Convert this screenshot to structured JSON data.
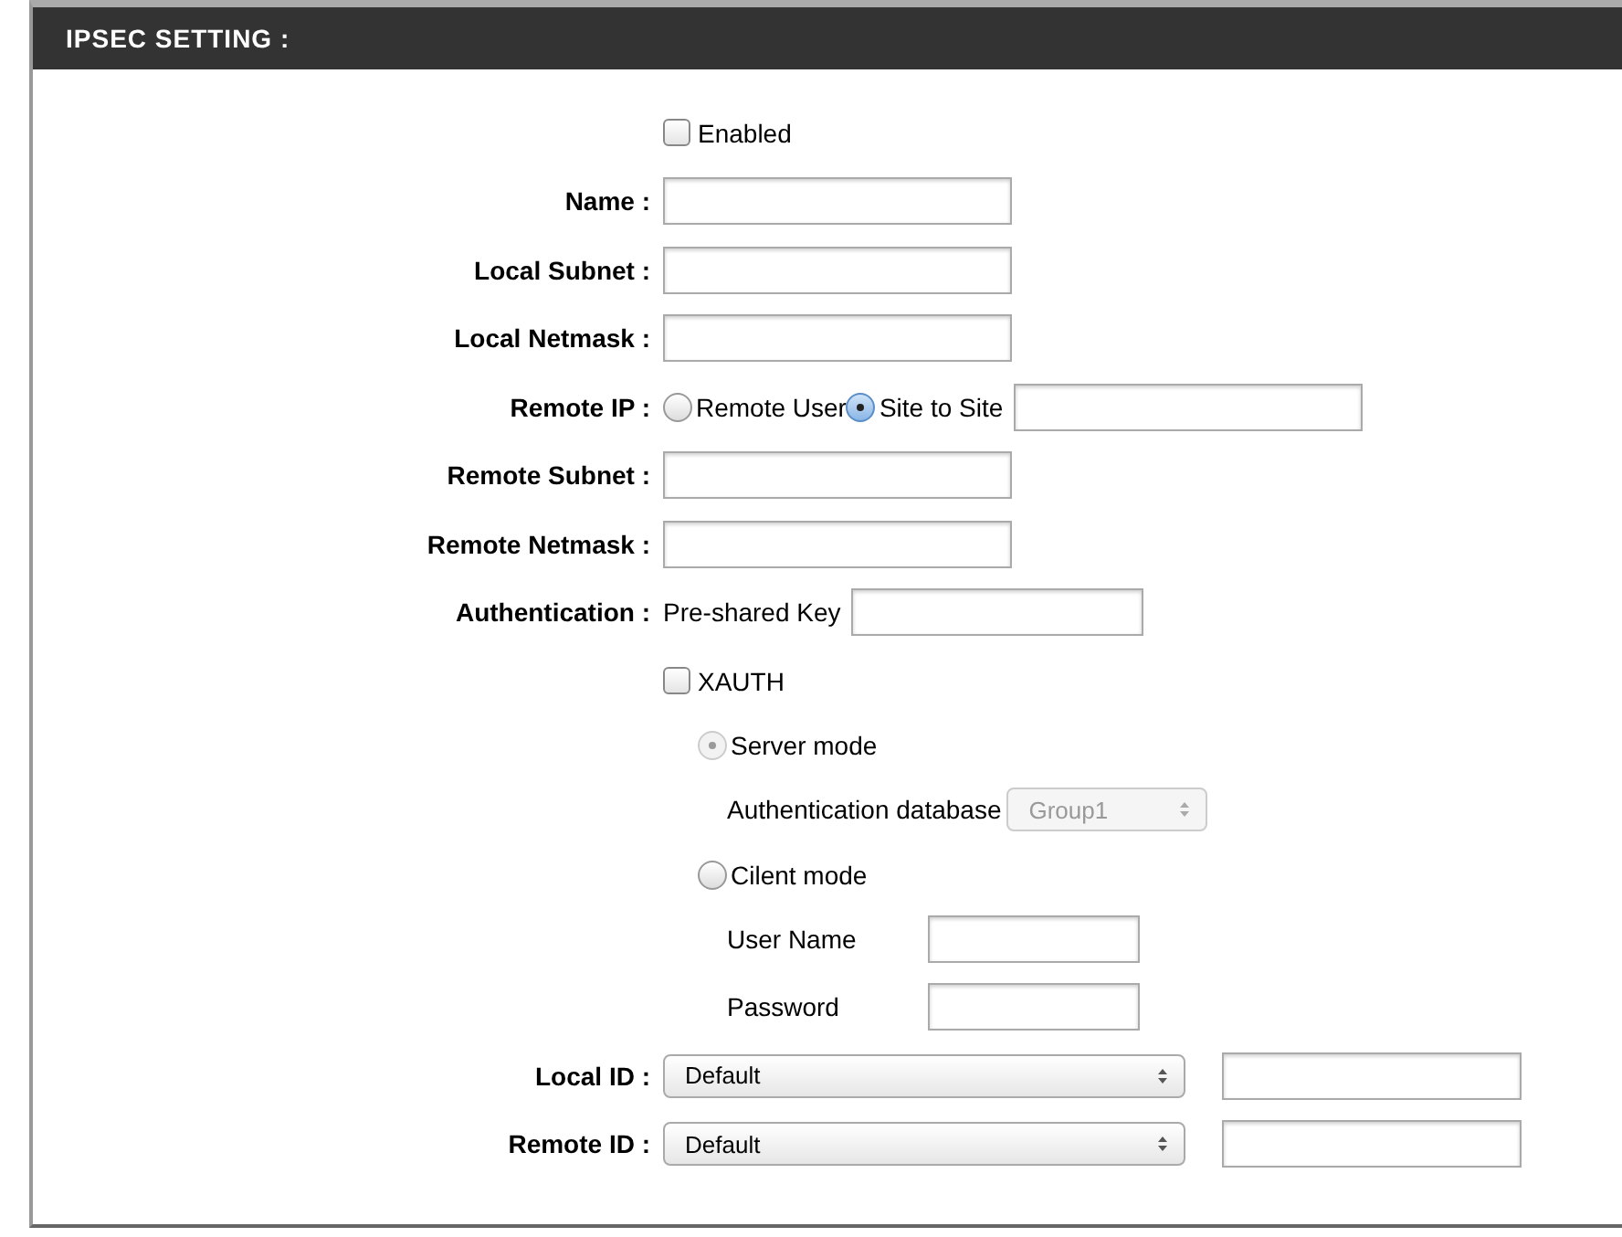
{
  "section": {
    "title": "IPSEC SETTING :"
  },
  "rows": [
    {
      "kind": "checkbox",
      "label": "Enabled",
      "checked": false
    },
    {
      "kind": "text",
      "label": "Name :"
    },
    {
      "kind": "text",
      "label": "Local Subnet :"
    },
    {
      "kind": "text",
      "label": "Local Netmask :"
    },
    {
      "kind": "radios",
      "label": "Remote IP :",
      "options": [
        {
          "label": "Remote User",
          "selected": false
        },
        {
          "label": "Site to Site",
          "selected": true
        }
      ]
    },
    {
      "kind": "text",
      "label": "Remote Subnet :"
    },
    {
      "kind": "text",
      "label": "Remote Netmask :"
    },
    {
      "kind": "prefixed",
      "label": "Authentication :",
      "prefix": "Pre-shared Key"
    },
    {
      "kind": "checkbox",
      "label": "XAUTH",
      "checked": false
    },
    {
      "kind": "mode",
      "label": "Server mode",
      "selected": true,
      "disabled": true
    },
    {
      "kind": "subselect",
      "label": "Authentication database",
      "value": "Group1",
      "disabled": true
    },
    {
      "kind": "mode",
      "label": "Cilent mode",
      "selected": false,
      "disabled": false
    },
    {
      "kind": "subtext",
      "label": "User Name"
    },
    {
      "kind": "subtext",
      "label": "Password"
    },
    {
      "kind": "select",
      "label": "Local ID :",
      "value": "Default"
    },
    {
      "kind": "select",
      "label": "Remote ID :",
      "value": "Default"
    }
  ]
}
